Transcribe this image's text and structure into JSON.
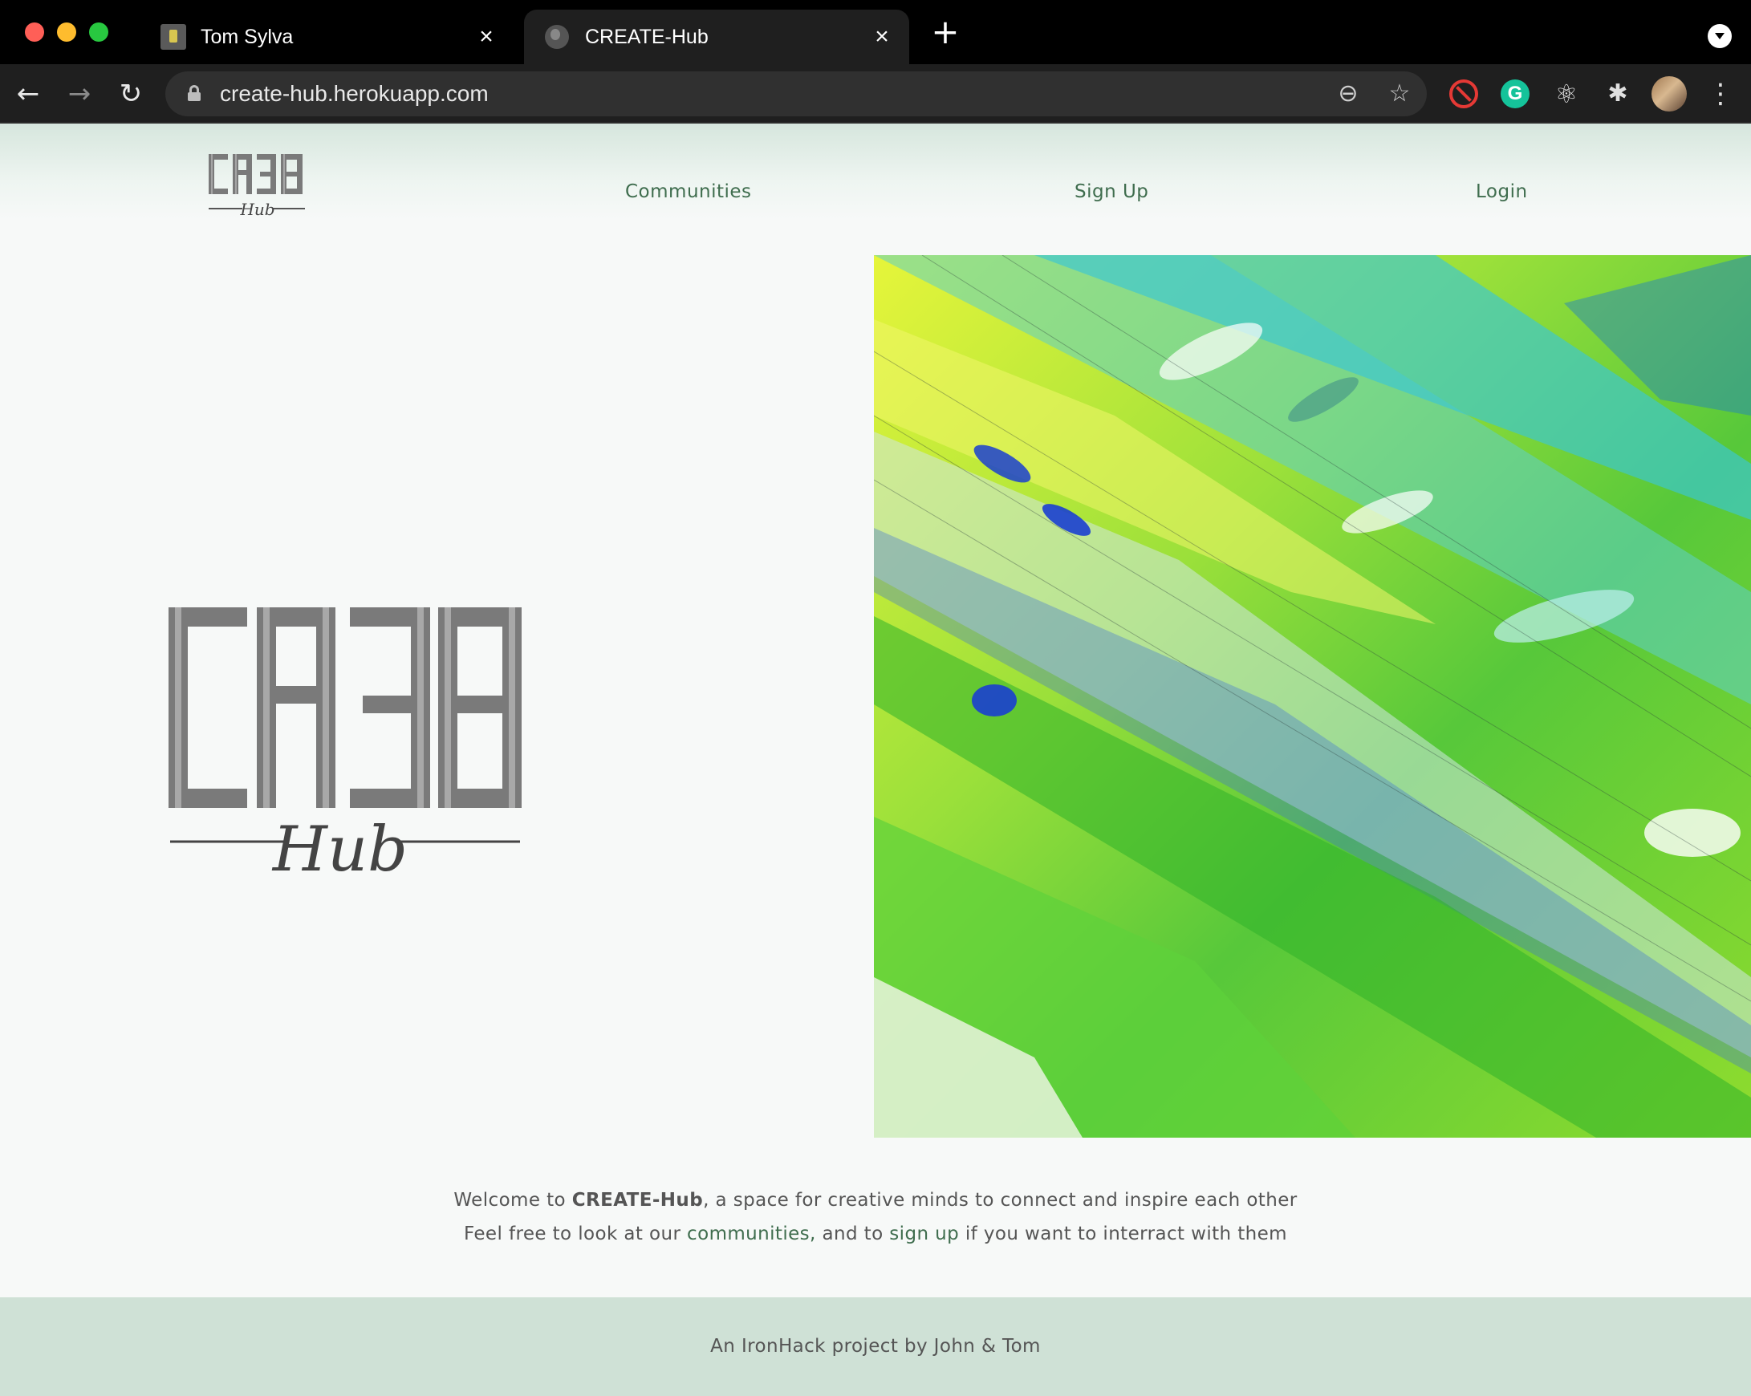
{
  "browser": {
    "tabs": [
      {
        "title": "Tom Sylva"
      },
      {
        "title": "CREATE-Hub"
      }
    ],
    "url": "create-hub.herokuapp.com",
    "icons": {
      "close": "×",
      "new_tab": "+",
      "back": "←",
      "forward": "→",
      "reload": "↻",
      "zoom": "⊖",
      "star": "☆",
      "react": "⚛",
      "puzzle": "✱",
      "menu": "⋮",
      "grammarly": "G"
    }
  },
  "site": {
    "logo": {
      "letters": "CR38",
      "sub": "Hub"
    },
    "nav": {
      "communities": "Communities",
      "signup": "Sign Up",
      "login": "Login"
    },
    "welcome": {
      "line1_pre": "Welcome to ",
      "brand": "CREATE-Hub",
      "line1_post": ", a space for creative minds to connect and inspire each other",
      "line2_pre": "Feel free to look at our ",
      "communities_link": "communities,",
      "line2_mid": " and to ",
      "signup_link": "sign up",
      "line2_post": " if you want to interract with them"
    },
    "footer": "An IronHack project by John & Tom"
  },
  "colors": {
    "link": "#3f6d4e",
    "header_tint": "#d6e6dd",
    "footer": "#cfe1d6",
    "logo_gray": "#7a7a7a"
  }
}
